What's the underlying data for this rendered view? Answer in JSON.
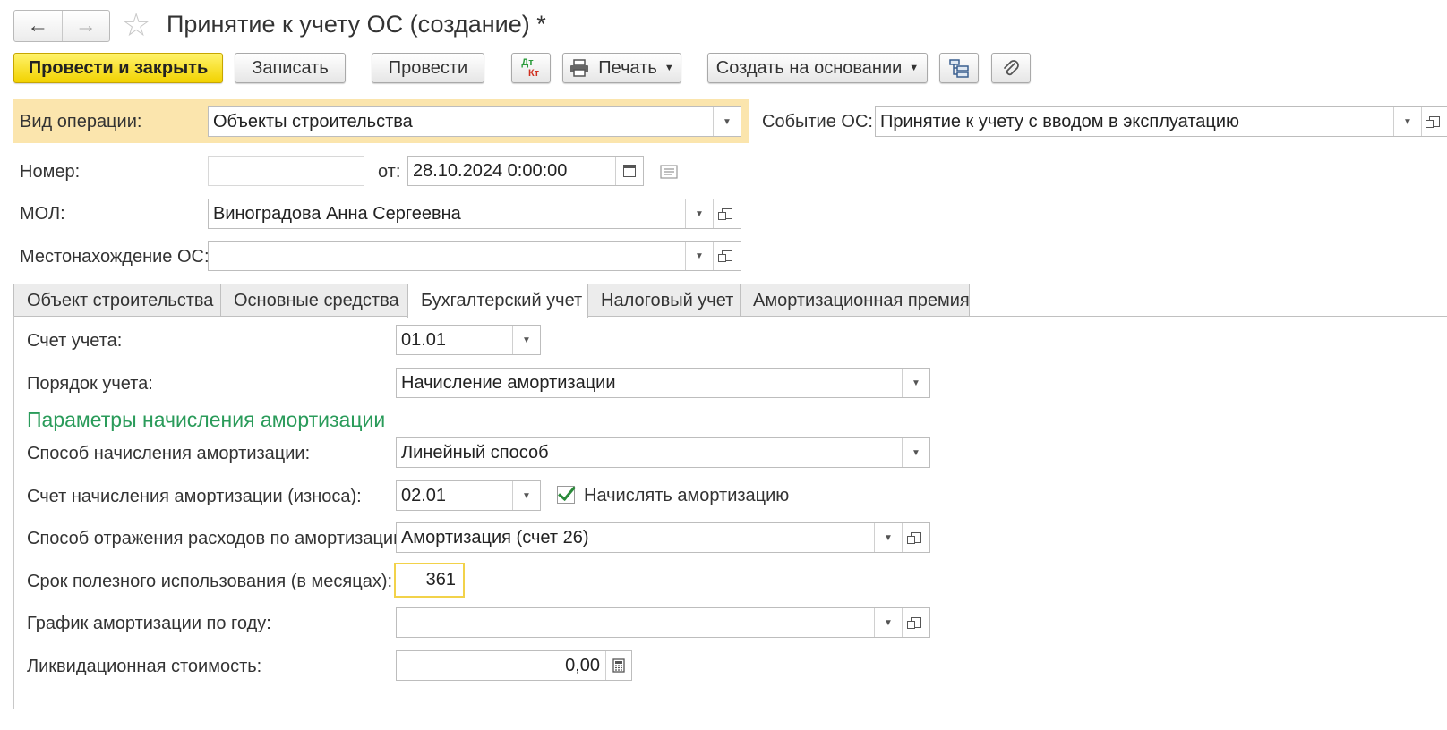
{
  "window": {
    "title": "Принятие к учету ОС (создание) *"
  },
  "nav": {
    "back": "←",
    "forward": "→",
    "favorite": "☆"
  },
  "toolbar": {
    "post_close": "Провести и закрыть",
    "save": "Записать",
    "post": "Провести",
    "dtkt_top": "Дт",
    "dtkt_bottom": "Кт",
    "print": "Печать",
    "create_based": "Создать на основании"
  },
  "header": {
    "operation_label": "Вид операции:",
    "operation_value": "Объекты строительства",
    "event_label": "Событие ОС:",
    "event_value": "Принятие к учету с вводом в эксплуатацию",
    "number_label": "Номер:",
    "number_value": "",
    "date_label": "от:",
    "date_value": "28.10.2024  0:00:00",
    "mol_label": "МОЛ:",
    "mol_value": "Виноградова Анна Сергеевна",
    "location_label": "Местонахождение ОС:",
    "location_value": ""
  },
  "tabs": [
    {
      "label": "Объект строительства"
    },
    {
      "label": "Основные средства"
    },
    {
      "label": "Бухгалтерский учет"
    },
    {
      "label": "Налоговый учет"
    },
    {
      "label": "Амортизационная премия"
    }
  ],
  "accounting": {
    "account_label": "Счет учета:",
    "account_value": "01.01",
    "order_label": "Порядок учета:",
    "order_value": "Начисление амортизации",
    "section_title": "Параметры начисления амортизации",
    "method_label": "Способ начисления амортизации:",
    "method_value": "Линейный способ",
    "dep_account_label": "Счет начисления амортизации (износа):",
    "dep_account_value": "02.01",
    "accrue_label": "Начислять амортизацию",
    "accrue_checked": true,
    "expense_label": "Способ отражения расходов по амортизации:",
    "expense_value": "Амортизация (счет 26)",
    "life_label": "Срок полезного использования (в месяцах):",
    "life_value": "361",
    "schedule_label": "График амортизации по году:",
    "schedule_value": "",
    "salvage_label": "Ликвидационная стоимость:",
    "salvage_value": "0,00"
  }
}
